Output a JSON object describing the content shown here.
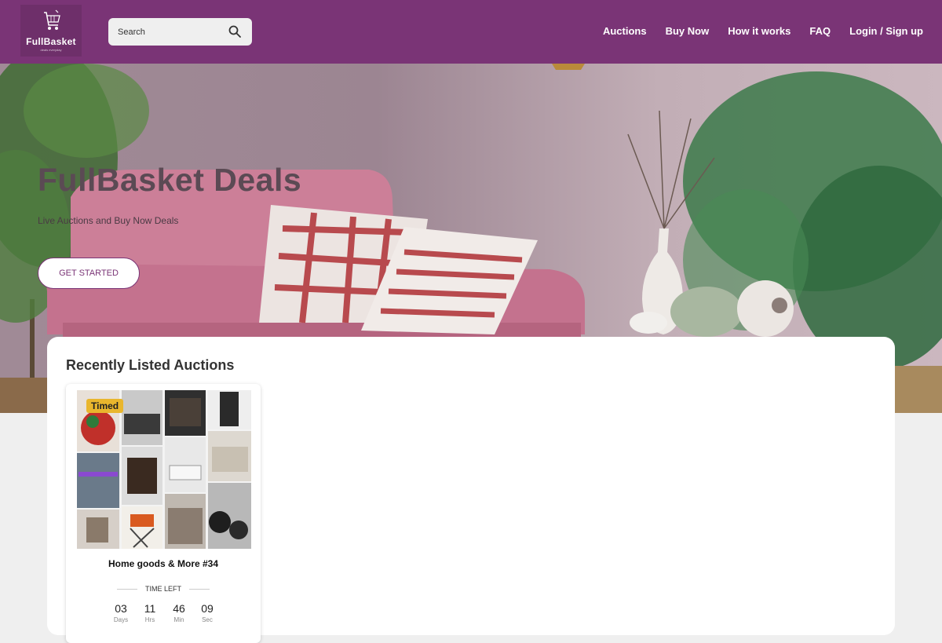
{
  "header": {
    "logo_text": "FullBasket",
    "logo_tagline": "deals everyday",
    "search_placeholder": "Search",
    "nav": [
      "Auctions",
      "Buy Now",
      "How it works",
      "FAQ",
      "Login / Sign up"
    ]
  },
  "hero": {
    "title": "FullBasket Deals",
    "subtitle": "Live Auctions and Buy Now Deals",
    "cta": "GET STARTED"
  },
  "section": {
    "title": "Recently Listed Auctions"
  },
  "auction_card": {
    "badge": "Timed",
    "title": "Home goods & More #34",
    "time_left_label": "TIME LEFT",
    "countdown": [
      {
        "value": "03",
        "unit": "Days"
      },
      {
        "value": "11",
        "unit": "Hrs"
      },
      {
        "value": "46",
        "unit": "Min"
      },
      {
        "value": "09",
        "unit": "Sec"
      }
    ]
  },
  "colors": {
    "brand": "#7a3476",
    "badge": "#e9b62d"
  },
  "icons": {
    "search": "search-icon",
    "logo": "shopping-cart-icon"
  }
}
